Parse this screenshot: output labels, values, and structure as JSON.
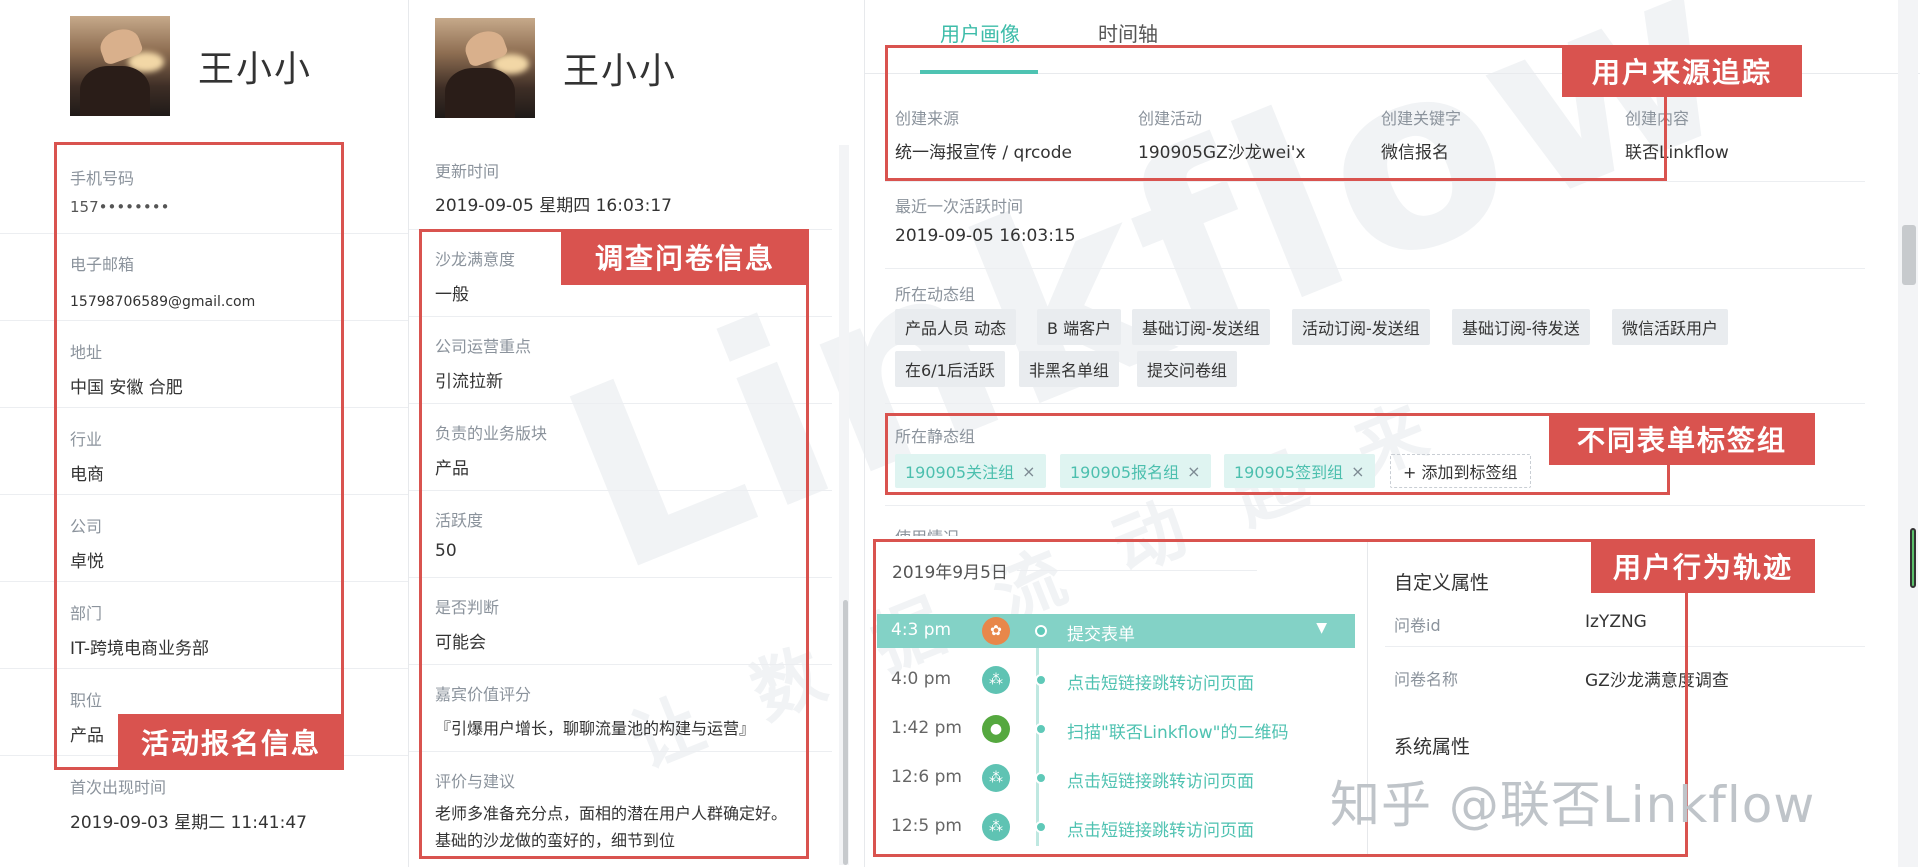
{
  "watermark": {
    "brand": "Linkflow",
    "slogan": "让数据流动起来"
  },
  "left_card": {
    "name": "王小小",
    "fields": [
      {
        "label": "手机号码",
        "value": "157••••••••"
      },
      {
        "label": "电子邮箱",
        "value": "15798706589@gmail.com"
      },
      {
        "label": "地址",
        "value": "中国 安徽 合肥"
      },
      {
        "label": "行业",
        "value": "电商"
      },
      {
        "label": "公司",
        "value": "卓悦"
      },
      {
        "label": "部门",
        "value": "IT-跨境电商业务部"
      },
      {
        "label": "职位",
        "value": "产品"
      },
      {
        "label": "首次出现时间",
        "value": "2019-09-03 星期二 11:41:47"
      }
    ],
    "annotation": "活动报名信息"
  },
  "middle_card": {
    "name": "王小小",
    "update_label": "更新时间",
    "update_value": "2019-09-05 星期四 16:03:17",
    "fields": [
      {
        "label": "沙龙满意度",
        "value": "一般"
      },
      {
        "label": "公司运营重点",
        "value": "引流拉新"
      },
      {
        "label": "负责的业务版块",
        "value": "产品"
      },
      {
        "label": "活跃度",
        "value": "50"
      },
      {
        "label": "是否判断",
        "value": "可能会"
      },
      {
        "label": "嘉宾价值评分",
        "value": "『引爆用户增长，聊聊流量池的构建与运营』"
      },
      {
        "label": "评价与建议",
        "value": "老师多准备充分点，面相的潜在用户人群确定好。基础的沙龙做的蛮好的，细节到位"
      }
    ],
    "annotation": "调查问卷信息"
  },
  "right_panel": {
    "tabs": [
      {
        "label": "用户画像"
      },
      {
        "label": "时间轴"
      }
    ],
    "source": {
      "annotation": "用户来源追踪",
      "columns": [
        {
          "label": "创建来源",
          "value": "统一海报宣传 / qrcode"
        },
        {
          "label": "创建活动",
          "value": "190905GZ沙龙wei'x"
        },
        {
          "label": "创建关键字",
          "value": "微信报名"
        },
        {
          "label": "创建内容",
          "value": "联否Linkflow"
        }
      ]
    },
    "last_active_label": "最近一次活跃时间",
    "last_active_value": "2019-09-05 16:03:15",
    "dynamic_groups_label": "所在动态组",
    "dynamic_groups": [
      "产品人员 动态",
      "B 端客户",
      "基础订阅-发送组",
      "活动订阅-发送组",
      "基础订阅-待发送",
      "微信活跃用户",
      "在6/1后活跃",
      "非黑名单组",
      "提交问卷组"
    ],
    "static_groups_label": "所在静态组",
    "static_groups": [
      "190905关注组",
      "190905报名组",
      "190905签到组"
    ],
    "static_close": "×",
    "add_tag_label": "+ 添加到标签组",
    "static_annotation": "不同表单标签组",
    "usage_label": "使用情况",
    "timeline": {
      "date": "2019年9月5日",
      "annotation": "用户行为轨迹",
      "events": [
        {
          "time": "4:3 pm",
          "text": "提交表单",
          "icon": "form-icon",
          "color": "#e8874a",
          "active": true
        },
        {
          "time": "4:0 pm",
          "text": "点击短链接跳转访问页面",
          "icon": "link-icon",
          "color": "#5fc3b3",
          "active": false
        },
        {
          "time": "1:42 pm",
          "text": "扫描\"联否Linkflow\"的二维码",
          "icon": "wechat-icon",
          "color": "#55a83f",
          "active": false
        },
        {
          "time": "12:6 pm",
          "text": "点击短链接跳转访问页面",
          "icon": "link-icon",
          "color": "#5fc3b3",
          "active": false
        },
        {
          "time": "12:5 pm",
          "text": "点击短链接跳转访问页面",
          "icon": "link-icon",
          "color": "#5fc3b3",
          "active": false
        }
      ]
    },
    "attributes": {
      "custom_title": "自定义属性",
      "items": [
        {
          "label": "问卷id",
          "value": "IzYZNG"
        },
        {
          "label": "问卷名称",
          "value": "GZ沙龙满意度调查"
        }
      ],
      "system_title": "系统属性"
    }
  },
  "footer_watermark": "知乎 @联否Linkflow",
  "colors": {
    "annotation_red": "#d9534f",
    "accent_teal": "#4ec3b2"
  }
}
